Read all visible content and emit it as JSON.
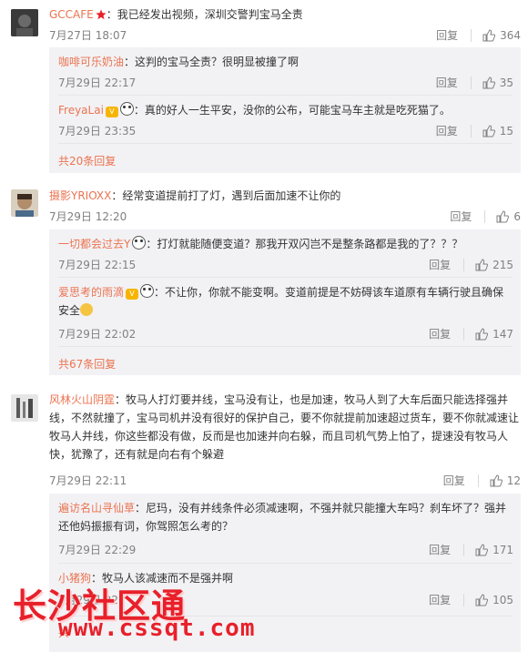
{
  "comments": [
    {
      "user": "GCCAFE",
      "text": "：我已经发出视频，深圳交警判宝马全责",
      "time": "7月27日 18:07",
      "reply_label": "回复",
      "likes": "364",
      "replies": [
        {
          "user": "咖啡可乐奶油",
          "text": "：这判的宝马全责？很明显被撞了啊",
          "time": "7月29日 22:17",
          "reply_label": "回复",
          "likes": "35"
        },
        {
          "user": "FreyaLai",
          "text": "：真的好人一生平安，没你的公布，可能宝马车主就是吃死猫了。",
          "time": "7月29日 23:35",
          "reply_label": "回复",
          "likes": "15"
        }
      ],
      "more": "共20条回复"
    },
    {
      "user": "摄影YRIOXX",
      "text": "：经常变道提前打了灯，遇到后面加速不让你的",
      "time": "7月29日 12:20",
      "reply_label": "回复",
      "likes": "6",
      "replies": [
        {
          "user": "一切都会过去Y",
          "text": "：打灯就能随便变道？那我开双闪岂不是整条路都是我的了？？？",
          "time": "7月29日 22:15",
          "reply_label": "回复",
          "likes": "215"
        },
        {
          "user": "爱思考的雨滴",
          "text": "：不让你，你就不能变啊。变道前提是不妨碍该车道原有车辆行驶且确保",
          "text2": "安全",
          "time": "7月29日 22:02",
          "reply_label": "回复",
          "likes": "147"
        }
      ],
      "more": "共67条回复"
    },
    {
      "user": "风林火山阴霆",
      "text_lines": [
        "：牧马人打灯要并线，宝马没有让，也是加速，牧马人到了大车后面只能选择强并",
        "线，不然就撞了，宝马司机并没有很好的保护自己，要不你就提前加速超过货车，要不你就减速让",
        "牧马人并线，你这些都没有做，反而是也加速并向右躲，而且司机气势上怕了，提速没有牧马人",
        "快，犹豫了，还有就是向右有个躲避"
      ],
      "time": "7月29日 22:11",
      "reply_label": "回复",
      "likes": "12",
      "replies": [
        {
          "user": "遍访名山寻仙草",
          "text": "：尼玛，没有并线条件必须减速啊，不强并就只能撞大车吗？刹车坏了？强并",
          "text2": "还他妈振振有词，你驾照怎么考的？",
          "time": "7月29日 22:29",
          "reply_label": "回复",
          "likes": "171"
        },
        {
          "user": "小猪狗",
          "text": "：牧马人该减速而不是强并啊",
          "time": "7月29日 22:",
          "reply_label": "回复",
          "likes": "105"
        }
      ],
      "more": "共"
    }
  ],
  "watermark": {
    "cn": "长沙社区通",
    "url": "www.cssqt.com"
  },
  "colors": {
    "username": "#eb7350",
    "meta": "#808080",
    "reply_bg": "#f2f2f5",
    "watermark": "#e8202a"
  }
}
